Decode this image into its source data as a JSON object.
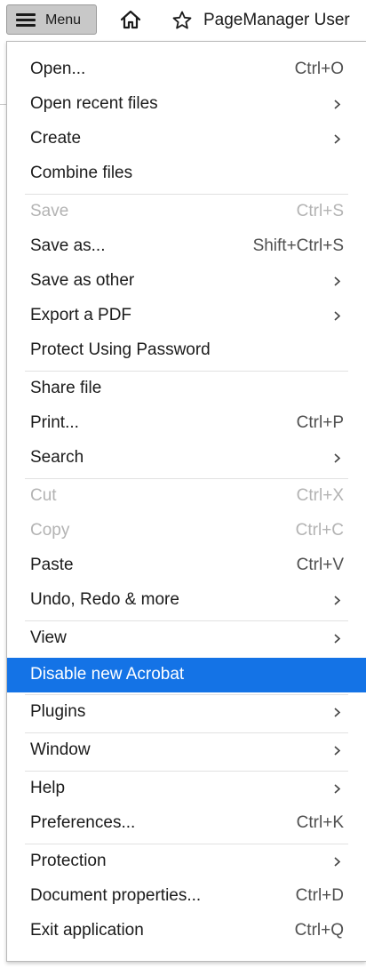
{
  "toolbar": {
    "menu_label": "Menu",
    "doc_title": "PageManager User"
  },
  "menu": {
    "open": {
      "label": "Open...",
      "shortcut": "Ctrl+O"
    },
    "open_recent": {
      "label": "Open recent files"
    },
    "create": {
      "label": "Create"
    },
    "combine": {
      "label": "Combine files"
    },
    "save": {
      "label": "Save",
      "shortcut": "Ctrl+S",
      "disabled": true
    },
    "save_as": {
      "label": "Save as...",
      "shortcut": "Shift+Ctrl+S"
    },
    "save_other": {
      "label": "Save as other"
    },
    "export_pdf": {
      "label": "Export a PDF"
    },
    "protect_pw": {
      "label": "Protect Using Password"
    },
    "share": {
      "label": "Share file"
    },
    "print": {
      "label": "Print...",
      "shortcut": "Ctrl+P"
    },
    "search": {
      "label": "Search"
    },
    "cut": {
      "label": "Cut",
      "shortcut": "Ctrl+X",
      "disabled": true
    },
    "copy": {
      "label": "Copy",
      "shortcut": "Ctrl+C",
      "disabled": true
    },
    "paste": {
      "label": "Paste",
      "shortcut": "Ctrl+V"
    },
    "undo_redo": {
      "label": "Undo, Redo & more"
    },
    "view": {
      "label": "View"
    },
    "disable_acrobat": {
      "label": "Disable new Acrobat"
    },
    "plugins": {
      "label": "Plugins"
    },
    "window": {
      "label": "Window"
    },
    "help": {
      "label": "Help"
    },
    "preferences": {
      "label": "Preferences...",
      "shortcut": "Ctrl+K"
    },
    "protection": {
      "label": "Protection"
    },
    "doc_props": {
      "label": "Document properties...",
      "shortcut": "Ctrl+D"
    },
    "exit": {
      "label": "Exit application",
      "shortcut": "Ctrl+Q"
    }
  },
  "colors": {
    "highlight": "#1473e6",
    "disabled_text": "#b3b3b3",
    "menu_button_bg": "#c8c8c8"
  },
  "icons": [
    "hamburger-icon",
    "home-icon",
    "star-icon",
    "chevron-right-icon"
  ]
}
